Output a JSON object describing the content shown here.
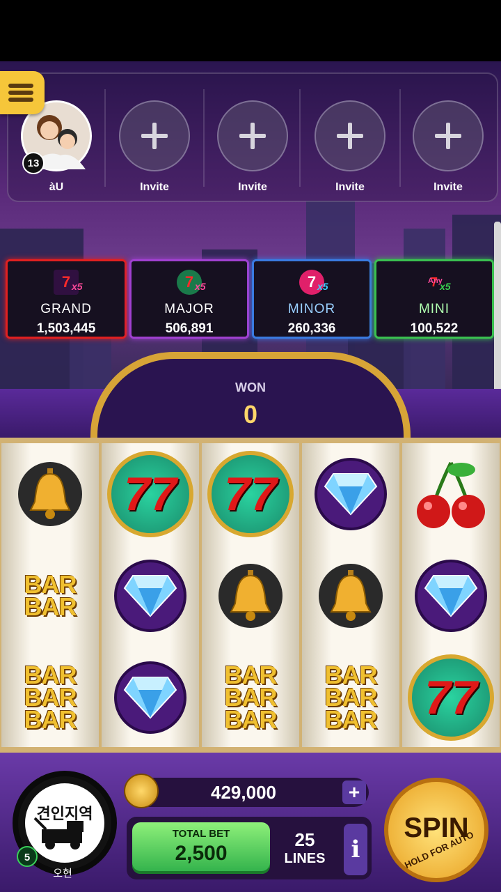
{
  "player": {
    "level": "13",
    "name": "àU"
  },
  "friends": [
    {
      "label": "Invite"
    },
    {
      "label": "Invite"
    },
    {
      "label": "Invite"
    },
    {
      "label": "Invite"
    }
  ],
  "jackpots": [
    {
      "name": "GRAND",
      "value": "1,503,445",
      "color": "#e02020",
      "icon": "triple-seven-icon"
    },
    {
      "name": "MAJOR",
      "value": "506,891",
      "color": "#a040d0",
      "icon": "double-seven-icon"
    },
    {
      "name": "MINOR",
      "value": "260,336",
      "color": "#3a7ae0",
      "icon": "single-seven-icon"
    },
    {
      "name": "MINI",
      "value": "100,522",
      "color": "#3ac050",
      "icon": "any-seven-icon"
    }
  ],
  "jackpot_multiplier": "x5",
  "jackpot_any": "Any",
  "won": {
    "label": "WON",
    "value": "0"
  },
  "reels": [
    [
      "bell",
      "bar-bar",
      "bar-bar-bar"
    ],
    [
      "seven",
      "diamond",
      "diamond"
    ],
    [
      "seven",
      "bell",
      "bar-bar-bar"
    ],
    [
      "diamond",
      "bell",
      "bar-bar-bar"
    ],
    [
      "cherry",
      "diamond",
      "seven"
    ]
  ],
  "symbol_text": {
    "seven": "77",
    "bar": "BAR"
  },
  "club": {
    "emblem_text": "견인지역",
    "level": "5",
    "name": "오현"
  },
  "coins": "429,000",
  "coins_add_label": "+",
  "bet": {
    "label": "TOTAL BET",
    "value": "2,500"
  },
  "lines": {
    "count": "25",
    "label": "LINES"
  },
  "info_label": "i",
  "spin": {
    "label": "SPIN",
    "hold_label": "HOLD FOR AUTO"
  }
}
